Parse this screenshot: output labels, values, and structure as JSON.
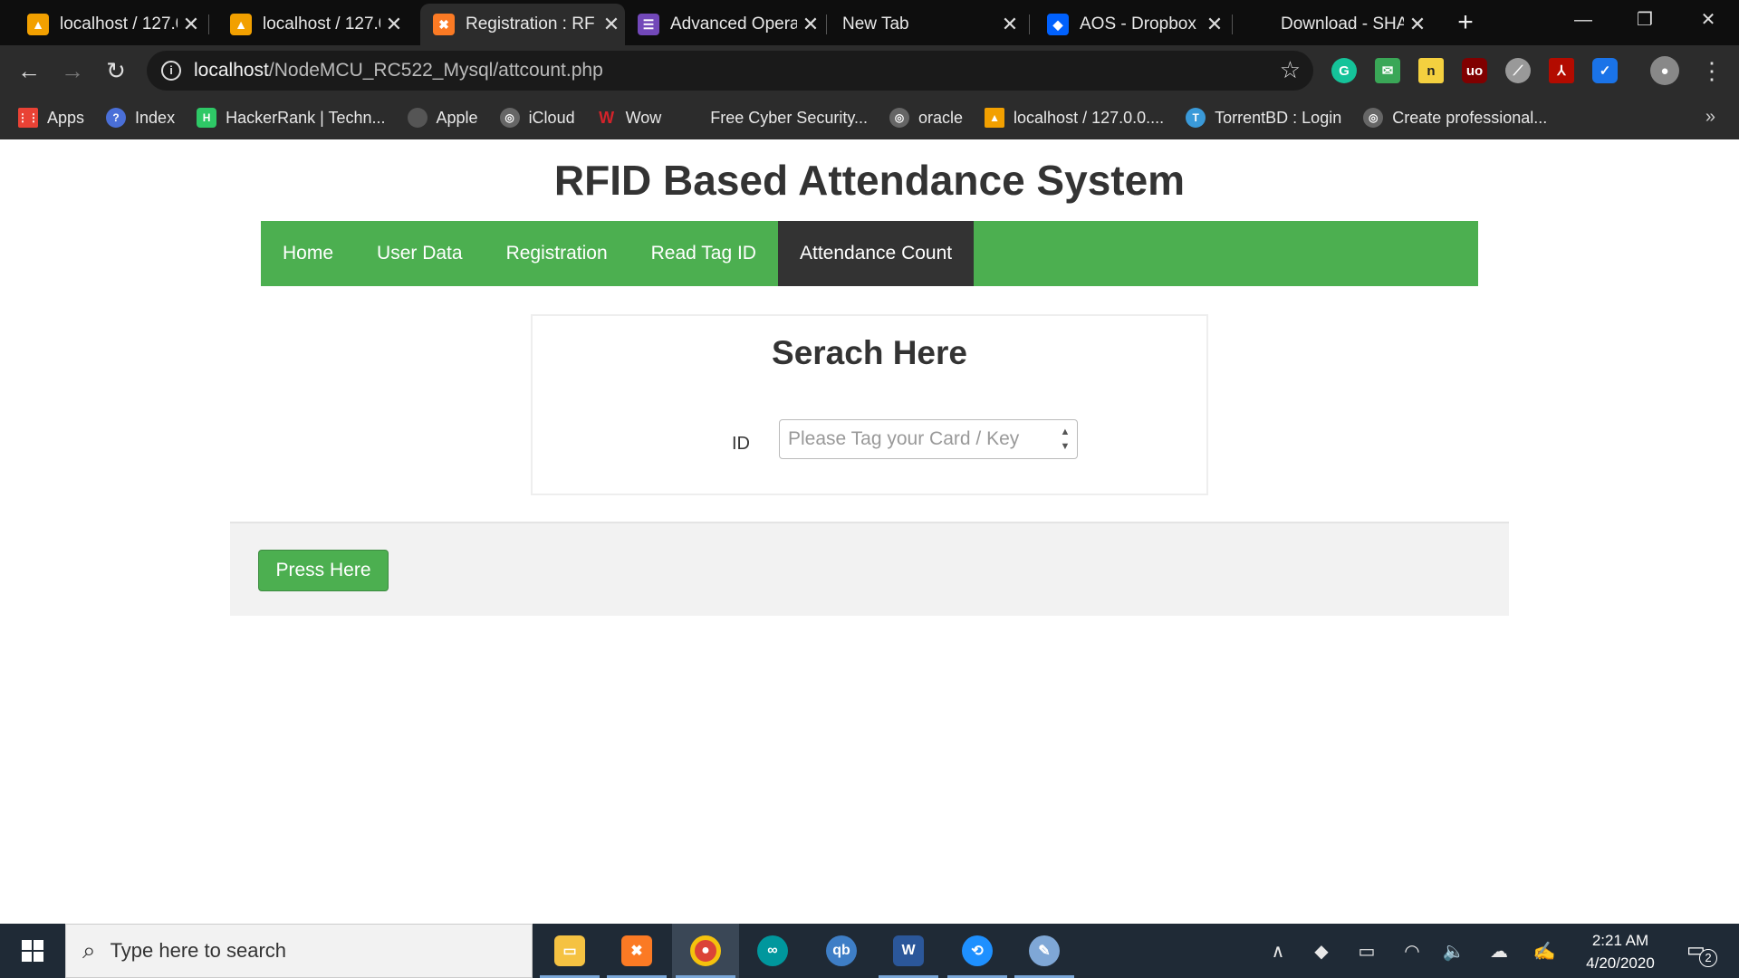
{
  "browser": {
    "tabs": [
      {
        "title": "localhost / 127.0",
        "favicon": "phpmyadmin-icon",
        "color": "#f2a000"
      },
      {
        "title": "localhost / 127.0",
        "favicon": "phpmyadmin-icon",
        "color": "#f2a000"
      },
      {
        "title": "Registration : RF",
        "favicon": "xampp-icon",
        "color": "#fb7a24",
        "active": true
      },
      {
        "title": "Advanced Opera",
        "favicon": "form-icon",
        "color": "#7248b9"
      },
      {
        "title": "New Tab",
        "favicon": "",
        "color": ""
      },
      {
        "title": "AOS - Dropbox",
        "favicon": "dropbox-icon",
        "color": "#0061fe"
      },
      {
        "title": "Download - SHA",
        "favicon": "",
        "color": ""
      }
    ],
    "url_host": "localhost",
    "url_path": "/NodeMCU_RC522_Mysql/attcount.php",
    "bookmarks": [
      {
        "label": "Apps",
        "icon": "apps-grid-icon",
        "color": "#e94235"
      },
      {
        "label": "Index",
        "icon": "index-icon",
        "color": "#4a6fd8"
      },
      {
        "label": "HackerRank | Techn...",
        "icon": "hackerrank-icon",
        "color": "#2ec866"
      },
      {
        "label": "Apple",
        "icon": "apple-icon",
        "color": "#555555"
      },
      {
        "label": "iCloud",
        "icon": "globe-icon",
        "color": "#666666"
      },
      {
        "label": "Wow",
        "icon": "wow-icon",
        "color": "#d2232a"
      },
      {
        "label": "Free Cyber Security...",
        "icon": "",
        "color": ""
      },
      {
        "label": "oracle",
        "icon": "globe-icon",
        "color": "#666666"
      },
      {
        "label": "localhost / 127.0.0....",
        "icon": "phpmyadmin-icon",
        "color": "#f2a000"
      },
      {
        "label": "TorrentBD : Login",
        "icon": "torrentbd-icon",
        "color": "#3a9ad9"
      },
      {
        "label": "Create professional...",
        "icon": "globe-icon",
        "color": "#666666"
      }
    ]
  },
  "page": {
    "site_title": "RFID Based Attendance System",
    "nav": [
      "Home",
      "User Data",
      "Registration",
      "Read Tag ID",
      "Attendance Count"
    ],
    "active_nav": "Attendance Count",
    "search_heading": "Serach Here",
    "id_label": "ID",
    "id_placeholder": "Please Tag your Card / Key",
    "button_label": "Press Here",
    "accent_color": "#4caf50"
  },
  "taskbar": {
    "search_placeholder": "Type here to search",
    "time": "2:21 AM",
    "date": "4/20/2020",
    "notification_count": "2"
  }
}
